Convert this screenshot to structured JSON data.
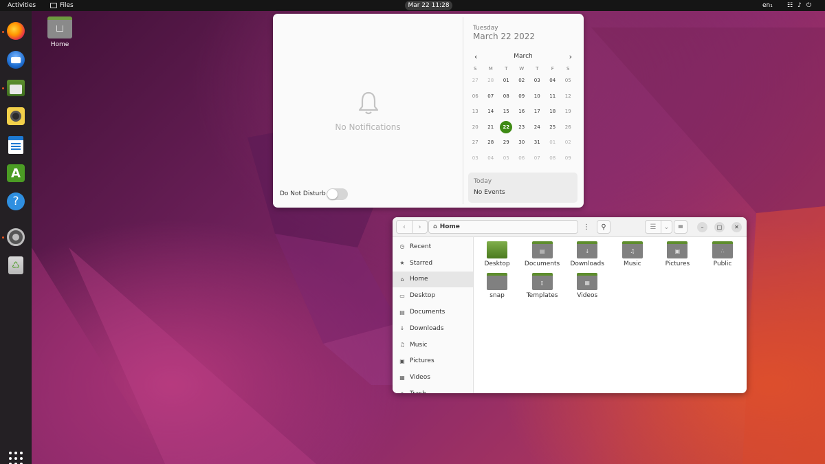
{
  "topbar": {
    "activities": "Activities",
    "app_name": "Files",
    "clock": "Mar 22  11:28",
    "language": "en₁",
    "status_icons": [
      "network-icon",
      "volume-icon",
      "power-icon"
    ]
  },
  "dock": {
    "apps": [
      {
        "name": "firefox",
        "running": true
      },
      {
        "name": "thunderbird",
        "running": false
      },
      {
        "name": "files",
        "running": true
      },
      {
        "name": "rhythmbox",
        "running": false
      },
      {
        "name": "libreoffice-writer",
        "running": false
      },
      {
        "name": "software-store",
        "running": false
      },
      {
        "name": "help",
        "running": false
      },
      {
        "name": "settings",
        "running": true
      },
      {
        "name": "trash",
        "running": false
      }
    ],
    "accent": "#e95420"
  },
  "desktop": {
    "home_label": "Home"
  },
  "notifications": {
    "empty_text": "No Notifications",
    "dnd_label": "Do Not Disturb",
    "dnd_enabled": false
  },
  "calendar": {
    "weekday": "Tuesday",
    "full_date": "March 22 2022",
    "month": "March",
    "weekday_headers": [
      "S",
      "M",
      "T",
      "W",
      "T",
      "F",
      "S"
    ],
    "weeks": [
      [
        "27",
        "28",
        "01",
        "02",
        "03",
        "04",
        "05"
      ],
      [
        "06",
        "07",
        "08",
        "09",
        "10",
        "11",
        "12"
      ],
      [
        "13",
        "14",
        "15",
        "16",
        "17",
        "18",
        "19"
      ],
      [
        "20",
        "21",
        "22",
        "23",
        "24",
        "25",
        "26"
      ],
      [
        "27",
        "28",
        "29",
        "30",
        "31",
        "01",
        "02"
      ],
      [
        "03",
        "04",
        "05",
        "06",
        "07",
        "08",
        "09"
      ]
    ],
    "today": "22",
    "today_color": "#3e8a14",
    "events_header": "Today",
    "events_text": "No Events"
  },
  "files": {
    "path": "Home",
    "sidebar": [
      {
        "label": "Recent",
        "icon": "clock-icon",
        "glyph": "◷"
      },
      {
        "label": "Starred",
        "icon": "star-icon",
        "glyph": "★"
      },
      {
        "label": "Home",
        "icon": "home-icon",
        "glyph": "⌂",
        "active": true
      },
      {
        "label": "Desktop",
        "icon": "desktop-icon",
        "glyph": "▭"
      },
      {
        "label": "Documents",
        "icon": "document-icon",
        "glyph": "▤"
      },
      {
        "label": "Downloads",
        "icon": "download-icon",
        "glyph": "↓"
      },
      {
        "label": "Music",
        "icon": "music-icon",
        "glyph": "♫"
      },
      {
        "label": "Pictures",
        "icon": "picture-icon",
        "glyph": "▣"
      },
      {
        "label": "Videos",
        "icon": "video-icon",
        "glyph": "▦"
      },
      {
        "label": "Trash",
        "icon": "trash-icon",
        "glyph": "♺"
      }
    ],
    "folders": [
      {
        "label": "Desktop",
        "icon": "desktop-folder-icon",
        "glyph": ""
      },
      {
        "label": "Documents",
        "icon": "documents-folder-icon",
        "glyph": "▤"
      },
      {
        "label": "Downloads",
        "icon": "downloads-folder-icon",
        "glyph": "↓"
      },
      {
        "label": "Music",
        "icon": "music-folder-icon",
        "glyph": "♫"
      },
      {
        "label": "Pictures",
        "icon": "pictures-folder-icon",
        "glyph": "▣"
      },
      {
        "label": "Public",
        "icon": "public-folder-icon",
        "glyph": "∴"
      },
      {
        "label": "snap",
        "icon": "snap-folder-icon",
        "glyph": ""
      },
      {
        "label": "Templates",
        "icon": "templates-folder-icon",
        "glyph": "▯"
      },
      {
        "label": "Videos",
        "icon": "videos-folder-icon",
        "glyph": "▦"
      }
    ]
  }
}
